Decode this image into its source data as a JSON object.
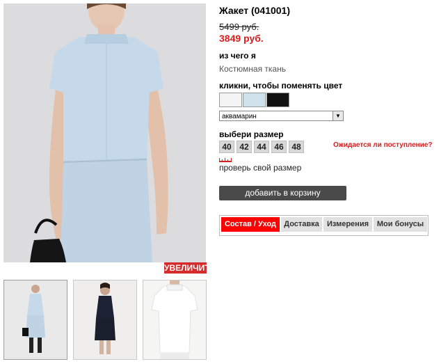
{
  "product": {
    "title": "Жакет (041001)",
    "old_price": "5499 руб.",
    "new_price": "3849 руб."
  },
  "material": {
    "heading": "из чего я",
    "value": "Костюмная ткань"
  },
  "color": {
    "heading": "кликни, чтобы поменять цвет",
    "swatches": [
      "#f4f4f4",
      "#cfe2ec",
      "#111111"
    ],
    "selected": "аквамарин"
  },
  "size": {
    "heading": "выбери размер",
    "options": [
      "40",
      "42",
      "44",
      "46",
      "48"
    ],
    "restock_link": "Ожидается ли поступление?",
    "check_link": "проверь свой размер"
  },
  "gallery": {
    "zoom_label": "УВЕЛИЧИТЬ"
  },
  "cart": {
    "button_label": "добавить в корзину"
  },
  "tabs": [
    "Состав / Уход",
    "Доставка",
    "Измерения",
    "Мои бонусы"
  ],
  "colors": {
    "accent_red": "#e01b1b",
    "active_tab": "#ff0000",
    "cart_button": "#4a4a4a"
  }
}
